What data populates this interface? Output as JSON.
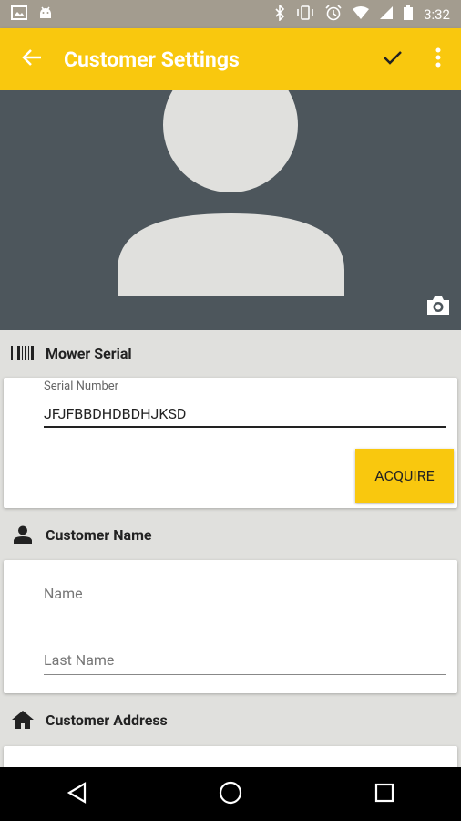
{
  "status_bar": {
    "time": "3:32"
  },
  "app_bar": {
    "title": "Customer Settings"
  },
  "sections": {
    "mower_serial": {
      "title": "Mower Serial",
      "serial_label": "Serial Number",
      "serial_value": "JFJFBBDHDBDHJKSD",
      "acquire_label": "ACQUIRE"
    },
    "customer_name": {
      "title": "Customer Name",
      "name_placeholder": "Name",
      "last_name_placeholder": "Last Name"
    },
    "customer_address": {
      "title": "Customer Address"
    }
  },
  "icons": {
    "status_left": [
      "image-icon",
      "android-icon"
    ],
    "status_right": [
      "bluetooth-icon",
      "vibrate-icon",
      "alarm-icon",
      "wifi-icon",
      "signal-icon",
      "battery-icon"
    ],
    "app_bar": [
      "back-arrow-icon",
      "check-icon",
      "more-vert-icon"
    ],
    "nav": [
      "back-triangle-icon",
      "home-circle-icon",
      "recents-square-icon"
    ]
  },
  "colors": {
    "accent": "#f9c80e",
    "header_bg": "#4d565c",
    "placeholder_shape": "#e0e0dd",
    "status_bar": "#a39c8f",
    "background": "#e0e0dd"
  }
}
